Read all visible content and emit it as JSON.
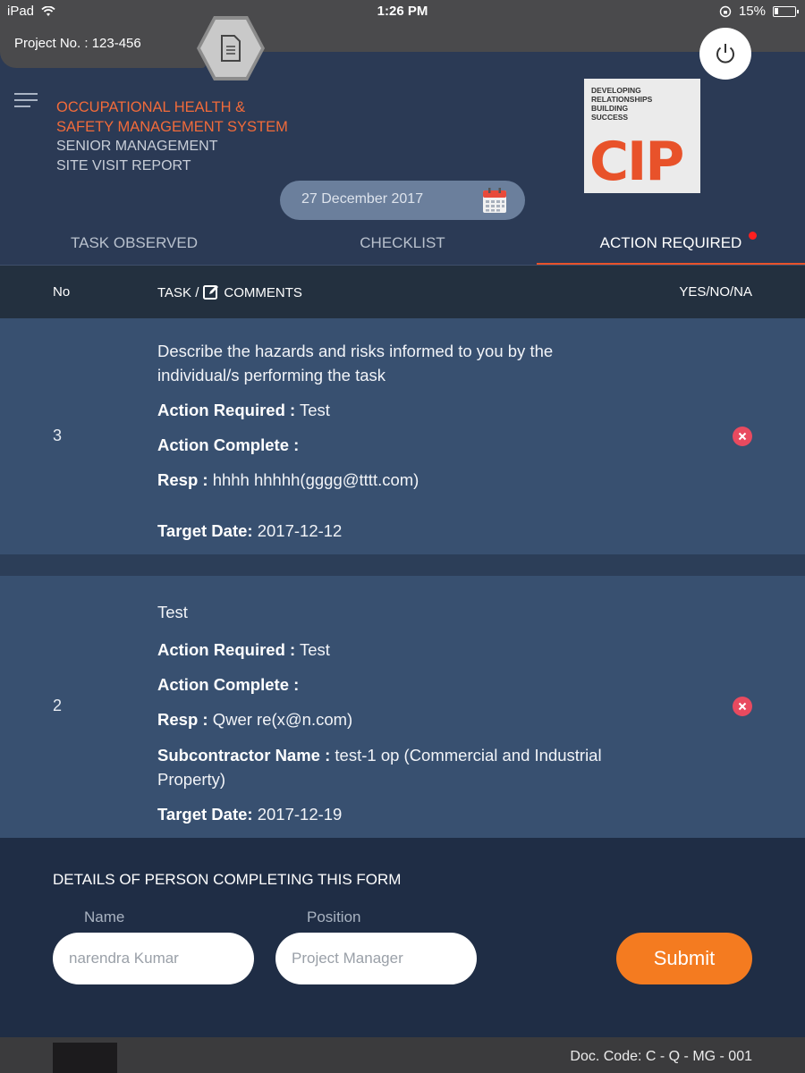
{
  "status_bar": {
    "device": "iPad",
    "time": "1:26 PM",
    "battery": "15%"
  },
  "project": {
    "label": "Project No. : 123-456"
  },
  "header": {
    "title_line1": "OCCUPATIONAL HEALTH &",
    "title_line2": "SAFETY MANAGEMENT SYSTEM",
    "subtitle_line1": "SENIOR MANAGEMENT",
    "subtitle_line2": "SITE VISIT REPORT",
    "date": "27 December 2017"
  },
  "logo": {
    "tagline_line1": "DEVELOPING",
    "tagline_line2": "RELATIONSHIPS",
    "tagline_line3": "BUILDING",
    "tagline_line4": "SUCCESS",
    "mark": "CIP"
  },
  "tabs": [
    {
      "label": "TASK OBSERVED",
      "active": false
    },
    {
      "label": "CHECKLIST",
      "active": false
    },
    {
      "label": "ACTION REQUIRED",
      "active": true
    }
  ],
  "table": {
    "col_no": "No",
    "col_task_prefix": "TASK /",
    "col_task_suffix": "COMMENTS",
    "col_yesno": "YES/NO/NA",
    "rows": [
      {
        "no": "3",
        "description_line1": "Describe the hazards and risks informed to you by the",
        "description_line2": "individual/s performing the task",
        "action_required_label": "Action Required :",
        "action_required_value": "Test",
        "action_complete_label": "Action Complete :",
        "resp_label": "Resp :",
        "resp_value": "hhhh hhhhh(gggg@tttt.com)",
        "target_label": "Target Date:",
        "target_value": "2017-12-12"
      },
      {
        "no": "2",
        "description_line1": "Test",
        "action_required_label": "Action Required :",
        "action_required_value": "Test",
        "action_complete_label": "Action Complete :",
        "resp_label": "Resp :",
        "resp_value": "Qwer re(x@n.com)",
        "subcontractor_label": "Subcontractor Name :",
        "subcontractor_value_line1": "test-1 op (Commercial and Industrial",
        "subcontractor_value_line2": "Property)",
        "target_label": "Target Date:",
        "target_value": "2017-12-19"
      }
    ]
  },
  "form": {
    "title": "DETAILS OF PERSON COMPLETING THIS FORM",
    "name_label": "Name",
    "name_value": "narendra Kumar",
    "position_label": "Position",
    "position_value": "Project Manager",
    "submit_label": "Submit"
  },
  "footer": {
    "doc_code": "Doc. Code: C - Q - MG - 001"
  },
  "colors": {
    "accent_orange": "#f26b3a",
    "submit_orange": "#f47b20",
    "background": "#2b3a55",
    "row_bg": "#385070",
    "delete_red": "#e84a5f"
  }
}
